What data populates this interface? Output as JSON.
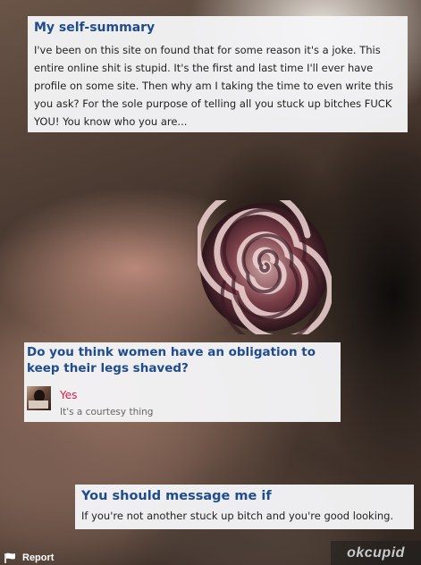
{
  "summary": {
    "heading": "My self-summary",
    "text": "I've been on this site on found that for some reason it's a joke. This entire online shit is stupid. It's the first and last time I'll ever have profile on some site. Then why am I taking the time to even write this you ask? For the sole purpose of telling all you stuck up bitches FUCK YOU! You know who you are..."
  },
  "question": {
    "heading": "Do you think women have an obligation to keep their legs shaved?",
    "answer": "Yes",
    "note": "It's a courtesy thing"
  },
  "message": {
    "heading": "You should message me if",
    "text": "If you're not another stuck up bitch and you're good looking."
  },
  "footer": {
    "report_label": "Report",
    "logo_text": "okcupid"
  },
  "colors": {
    "heading_blue": "#1f4c8f",
    "answer_red": "#d51b4a"
  },
  "icons": {
    "report": "flag-icon"
  }
}
